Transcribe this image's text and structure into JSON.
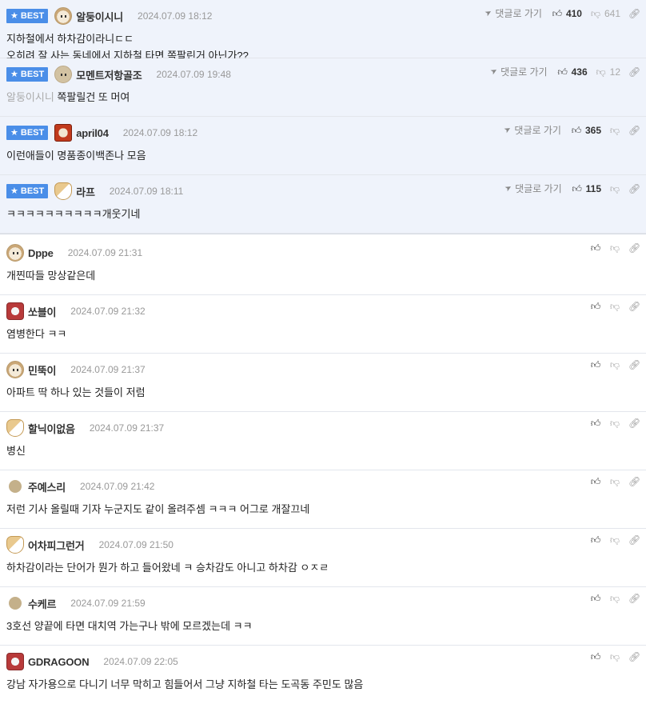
{
  "best_label": "BEST",
  "goto_label": "댓글로 가기",
  "best_comments": [
    {
      "nick": "알둥이시니",
      "date": "2024.07.09 18:12",
      "avatar": "dog-avatar",
      "lines": [
        "지하철에서 하차감이라니ㄷㄷ",
        "오히려 잘 사는 동네에서 지하철 타면 쪽팔린거 아닌가??"
      ],
      "up": "410",
      "down": "641"
    },
    {
      "nick": "모멘트저항골조",
      "date": "2024.07.09 19:48",
      "avatar": "dot-avatar",
      "reply_to": "알둥이시니",
      "lines": [
        "쪽팔릴건 또 머여"
      ],
      "up": "436",
      "down": "12"
    },
    {
      "nick": "april04",
      "date": "2024.07.09 18:12",
      "avatar": "lion-avatar",
      "lines": [
        "이런애들이 명품종이백존나 모음"
      ],
      "up": "365",
      "down": ""
    },
    {
      "nick": "라프",
      "date": "2024.07.09 18:11",
      "avatar": "fox-avatar",
      "lines": [
        "ㅋㅋㅋㅋㅋㅋㅋㅋㅋㅋ개웃기네"
      ],
      "up": "115",
      "down": ""
    }
  ],
  "comments": [
    {
      "nick": "Dppe",
      "date": "2024.07.09 21:31",
      "avatar": "dog-avatar",
      "text": "개찐따들 망상같은데"
    },
    {
      "nick": "쏘블이",
      "date": "2024.07.09 21:32",
      "avatar": "poodle-avatar",
      "text": "염병한다 ㅋㅋ"
    },
    {
      "nick": "민뚝이",
      "date": "2024.07.09 21:37",
      "avatar": "dog-avatar",
      "text": "아파트 딱 하나 있는 것들이 저럼"
    },
    {
      "nick": "할닉이없음",
      "date": "2024.07.09 21:37",
      "avatar": "fox-avatar",
      "text": "병신"
    },
    {
      "nick": "주예스리",
      "date": "2024.07.09 21:42",
      "avatar": "dot-avatar",
      "text": "저런 기사 올릴때 기자 누군지도 같이 올려주셈 ㅋㅋㅋ 어그로 개잘끄네"
    },
    {
      "nick": "어차피그런거",
      "date": "2024.07.09 21:50",
      "avatar": "fox-avatar",
      "text": "하차감이라는 단어가 뭔가 하고 들어왔네 ㅋ 승차감도 아니고 하차감 ㅇㅈㄹ"
    },
    {
      "nick": "수케르",
      "date": "2024.07.09 21:59",
      "avatar": "dot-avatar",
      "text": "3호선 양끝에 타면 대치역 가는구나 밖에 모르겠는데 ㅋㅋ"
    },
    {
      "nick": "GDRAGOON",
      "date": "2024.07.09 22:05",
      "avatar": "poodle-avatar",
      "text": "강남 자가용으로 다니기 너무 막히고 힘들어서 그냥 지하철 타는 도곡동 주민도 많음"
    }
  ]
}
